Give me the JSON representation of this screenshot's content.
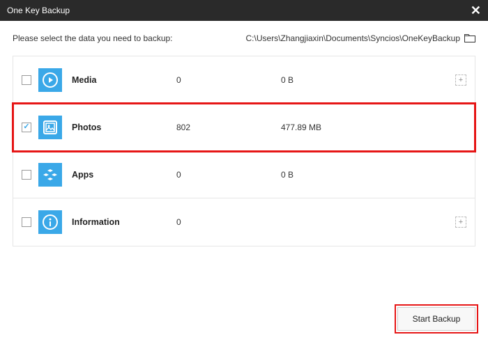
{
  "title": "One Key Backup",
  "prompt": "Please select the data you need to backup:",
  "path": "C:\\Users\\Zhangjiaxin\\Documents\\Syncios\\OneKeyBackup",
  "rows": [
    {
      "label": "Media",
      "count": "0",
      "size": "0 B",
      "checked": false,
      "highlighted": false,
      "has_add": true,
      "icon": "play"
    },
    {
      "label": "Photos",
      "count": "802",
      "size": "477.89 MB",
      "checked": true,
      "highlighted": true,
      "has_add": false,
      "icon": "image"
    },
    {
      "label": "Apps",
      "count": "0",
      "size": "0 B",
      "checked": false,
      "highlighted": false,
      "has_add": false,
      "icon": "apps"
    },
    {
      "label": "Information",
      "count": "0",
      "size": "",
      "checked": false,
      "highlighted": false,
      "has_add": true,
      "icon": "info"
    }
  ],
  "start_label": "Start Backup"
}
